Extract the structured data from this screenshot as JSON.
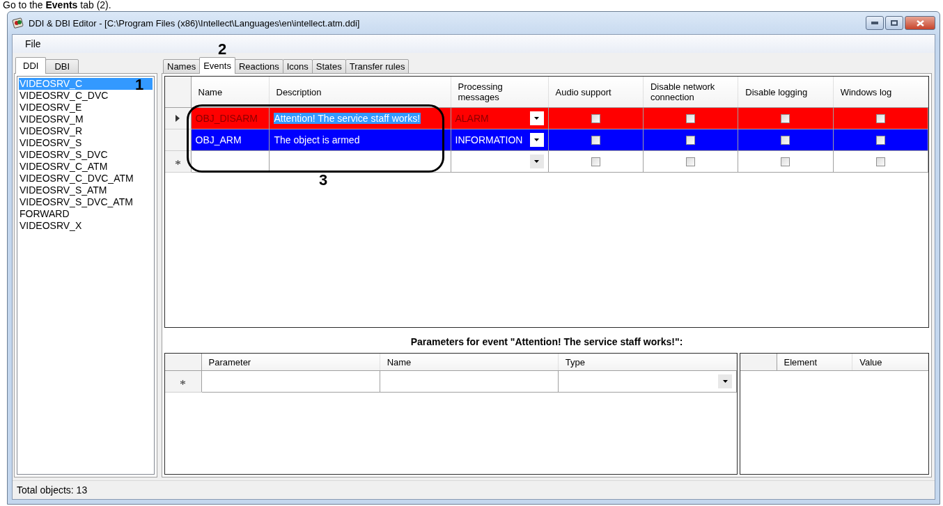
{
  "caption": "Go to the **Events** tab (2).",
  "window": {
    "title": "DDI & DBI Editor - [C:\\Program Files (x86)\\Intellect\\Languages\\en\\intellect.atm.ddi]"
  },
  "menu": [
    "File"
  ],
  "left_tabs": [
    {
      "label": "DDI",
      "selected": true
    },
    {
      "label": "DBI",
      "selected": false
    }
  ],
  "objects": [
    {
      "label": "VIDEOSRV_C",
      "selected": true
    },
    {
      "label": "VIDEOSRV_C_DVC",
      "selected": false
    },
    {
      "label": "VIDEOSRV_E",
      "selected": false
    },
    {
      "label": "VIDEOSRV_M",
      "selected": false
    },
    {
      "label": "VIDEOSRV_R",
      "selected": false
    },
    {
      "label": "VIDEOSRV_S",
      "selected": false
    },
    {
      "label": "VIDEOSRV_S_DVC",
      "selected": false
    },
    {
      "label": "VIDEOSRV_C_ATM",
      "selected": false
    },
    {
      "label": "VIDEOSRV_C_DVC_ATM",
      "selected": false
    },
    {
      "label": "VIDEOSRV_S_ATM",
      "selected": false
    },
    {
      "label": "VIDEOSRV_S_DVC_ATM",
      "selected": false
    },
    {
      "label": "FORWARD",
      "selected": false
    },
    {
      "label": "VIDEOSRV_X",
      "selected": false
    }
  ],
  "tabs": [
    {
      "label": "Names",
      "selected": false
    },
    {
      "label": "Events",
      "selected": true
    },
    {
      "label": "Reactions",
      "selected": false
    },
    {
      "label": "Icons",
      "selected": false
    },
    {
      "label": "States",
      "selected": false
    },
    {
      "label": "Transfer rules",
      "selected": false
    }
  ],
  "events_table": {
    "columns": [
      "Name",
      "Description",
      "Processing messages",
      "Audio support",
      "Disable network connection",
      "Disable logging",
      "Windows log"
    ],
    "rows": [
      {
        "kind": "current",
        "name": "OBJ_DISARM",
        "description": "Attention! The service staff works!",
        "description_selected": true,
        "processing": "ALARM",
        "color": "#ff0000",
        "checks": [
          false,
          false,
          false,
          false
        ]
      },
      {
        "kind": "data",
        "name": "OBJ_ARM",
        "description": "The object is armed",
        "description_selected": false,
        "processing": "INFORMATION",
        "color": "#0000ff",
        "checks": [
          false,
          false,
          false,
          false
        ]
      },
      {
        "kind": "new",
        "name": "",
        "description": "",
        "processing": "",
        "checks": [
          false,
          false,
          false,
          false
        ]
      }
    ]
  },
  "parameters_title": "Parameters for event \"Attention! The service staff works!\":",
  "parameters_table": {
    "columns": [
      "Parameter",
      "Name",
      "Type"
    ]
  },
  "elements_table": {
    "columns": [
      "Element",
      "Value"
    ]
  },
  "status_bar": "Total objects: 13",
  "annotations": [
    {
      "label": "1"
    },
    {
      "label": "2"
    },
    {
      "label": "3"
    }
  ]
}
